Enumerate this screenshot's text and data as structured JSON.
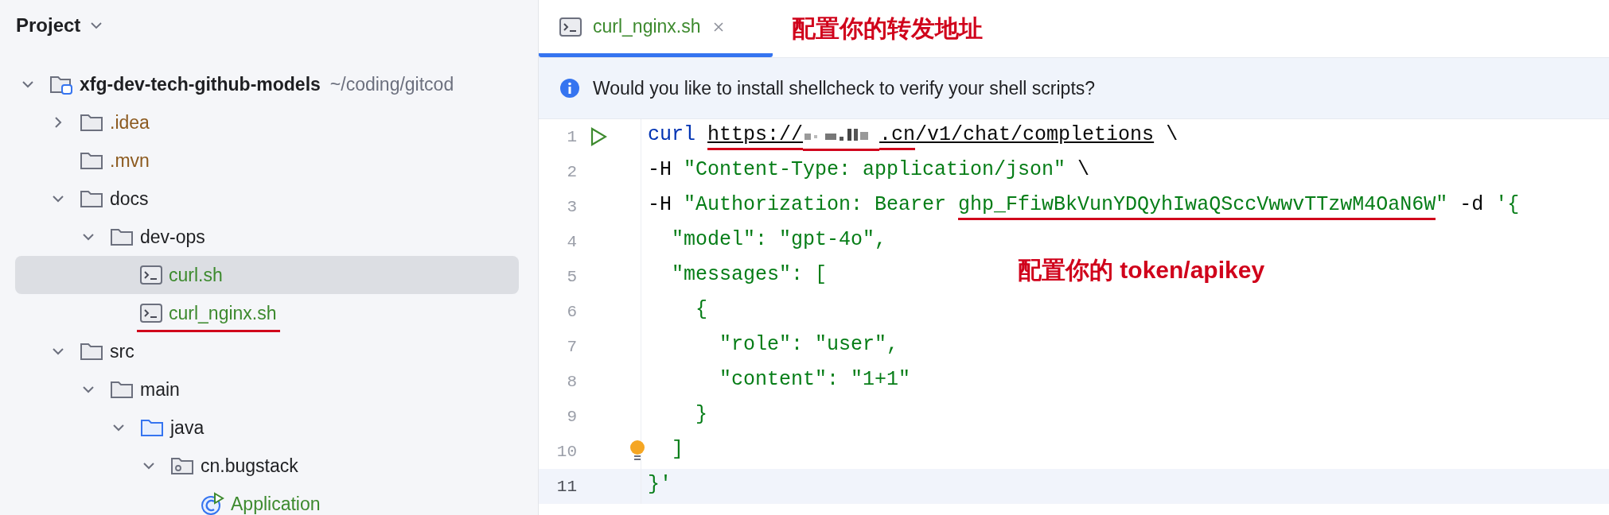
{
  "sidebar": {
    "title": "Project",
    "tree": [
      {
        "label": "xfg-dev-tech-github-models",
        "path": "~/coding/gitcod",
        "kind": "project",
        "color": "#1e1f22",
        "expanded": true,
        "selected": false,
        "children": [
          {
            "label": ".idea",
            "kind": "folder",
            "color": "#8c5a1f",
            "expanded": false,
            "selected": false
          },
          {
            "label": ".mvn",
            "kind": "folder",
            "color": "#8c5a1f",
            "selected": false
          },
          {
            "label": "docs",
            "kind": "folder",
            "color": "#1e1f22",
            "expanded": true,
            "selected": false,
            "children": [
              {
                "label": "dev-ops",
                "kind": "folder",
                "color": "#1e1f22",
                "expanded": true,
                "selected": false,
                "children": [
                  {
                    "label": "curl.sh",
                    "kind": "script",
                    "color": "#3d8a2e",
                    "selected": true
                  },
                  {
                    "label": "curl_nginx.sh",
                    "kind": "script",
                    "color": "#3d8a2e",
                    "selected": false,
                    "marked": true
                  }
                ]
              }
            ]
          },
          {
            "label": "src",
            "kind": "folder",
            "color": "#1e1f22",
            "expanded": true,
            "selected": false,
            "children": [
              {
                "label": "main",
                "kind": "folder",
                "color": "#1e1f22",
                "expanded": true,
                "selected": false,
                "children": [
                  {
                    "label": "java",
                    "kind": "source",
                    "color": "#1e1f22",
                    "expanded": true,
                    "selected": false,
                    "children": [
                      {
                        "label": "cn.bugstack",
                        "kind": "package",
                        "color": "#1e1f22",
                        "expanded": true,
                        "selected": false,
                        "children": [
                          {
                            "label": "Application",
                            "kind": "class",
                            "color": "#3d8a2e",
                            "selected": false
                          }
                        ]
                      }
                    ]
                  }
                ]
              }
            ]
          }
        ]
      }
    ]
  },
  "editor": {
    "tabs": [
      {
        "label": "curl_nginx.sh",
        "selected": true
      }
    ],
    "tab_annotation": "配置你的转发地址",
    "banner": "Would you like to install shellcheck to verify your shell scripts?",
    "annotation": "配置你的 token/apikey",
    "lines": [
      {
        "number": "1",
        "current": false,
        "kind": "run",
        "tokens": [
          {
            "kind": "keyword",
            "text": "curl "
          },
          {
            "kind": "url",
            "text": "https://",
            "marked": true
          },
          {
            "kind": "blur",
            "marked": true
          },
          {
            "kind": "url",
            "text": ".cn",
            "marked": true
          },
          {
            "kind": "url",
            "text": "/v1/chat/completions"
          },
          {
            "kind": "plain",
            "text": " \\"
          }
        ]
      },
      {
        "number": "2",
        "current": false,
        "tokens": [
          {
            "kind": "plain",
            "text": "-H "
          },
          {
            "kind": "string",
            "text": "\"Content-Type: application/json\""
          },
          {
            "kind": "plain",
            "text": " \\"
          }
        ]
      },
      {
        "number": "3",
        "current": false,
        "tokens": [
          {
            "kind": "plain",
            "text": "-H "
          },
          {
            "kind": "string",
            "text": "\"Authorization: Bearer "
          },
          {
            "kind": "string",
            "text": "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",
            "marked": true
          },
          {
            "kind": "string",
            "text": "\""
          },
          {
            "kind": "plain",
            "text": " -d "
          },
          {
            "kind": "string",
            "text": "'{"
          }
        ]
      },
      {
        "number": "4",
        "current": false,
        "tokens": [
          {
            "kind": "string",
            "text": "  \"model\": \"gpt-4o\","
          }
        ]
      },
      {
        "number": "5",
        "current": false,
        "tokens": [
          {
            "kind": "string",
            "text": "  \"messages\": ["
          }
        ]
      },
      {
        "number": "6",
        "current": false,
        "tokens": [
          {
            "kind": "string",
            "text": "    {"
          }
        ]
      },
      {
        "number": "7",
        "current": false,
        "tokens": [
          {
            "kind": "string",
            "text": "      \"role\": \"user\","
          }
        ]
      },
      {
        "number": "8",
        "current": false,
        "tokens": [
          {
            "kind": "string",
            "text": "      \"content\": \"1+1\""
          }
        ]
      },
      {
        "number": "9",
        "current": false,
        "tokens": [
          {
            "kind": "string",
            "text": "    }"
          }
        ]
      },
      {
        "number": "10",
        "current": false,
        "kind": "hint",
        "tokens": [
          {
            "kind": "string",
            "text": "  ]"
          }
        ]
      },
      {
        "number": "11",
        "current": true,
        "tokens": [
          {
            "kind": "string",
            "text": "}'"
          }
        ]
      }
    ]
  }
}
